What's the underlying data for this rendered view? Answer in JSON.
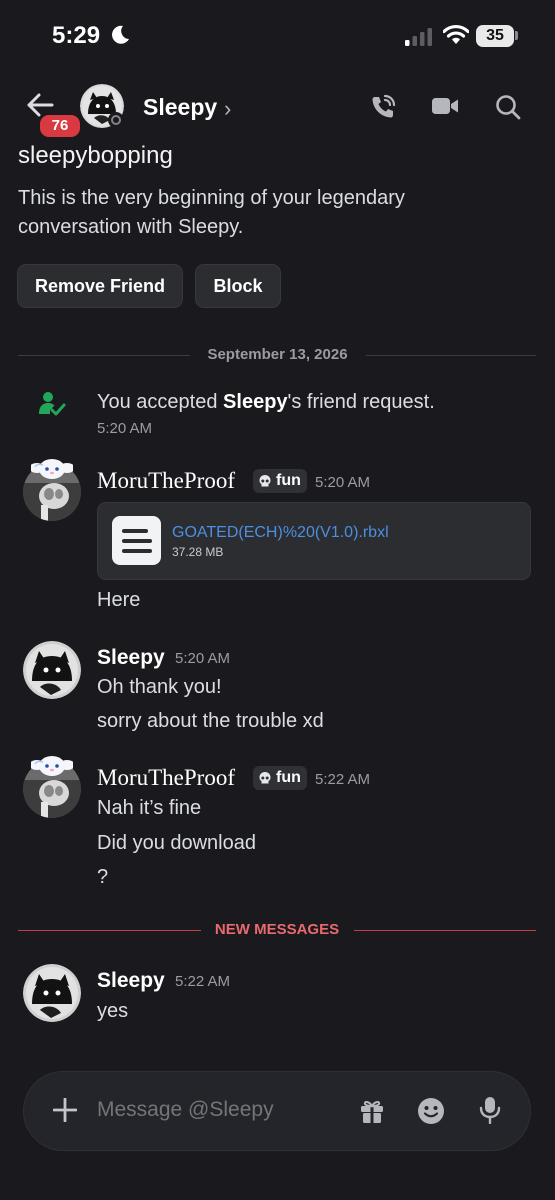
{
  "status_bar": {
    "time": "5:29",
    "battery": "35"
  },
  "header": {
    "unread_count": "76",
    "name": "Sleepy",
    "chevron": "›"
  },
  "intro": {
    "username": "sleepybopping",
    "text": "This is the very beginning of your legendary conversation with Sleepy.",
    "remove_friend_label": "Remove Friend",
    "block_label": "Block"
  },
  "date_divider": "September 13, 2026",
  "system_message": {
    "pre": "You accepted ",
    "name": "Sleepy",
    "post": "'s friend request.",
    "time": "5:20 AM"
  },
  "messages": [
    {
      "author": "MoruTheProof",
      "tag": "fun",
      "time": "5:20 AM",
      "attachment": {
        "name": "GOATED(ECH)%20(V1.0).rbxl",
        "size": "37.28 MB"
      },
      "lines": [
        "Here"
      ]
    },
    {
      "author": "Sleepy",
      "time": "5:20 AM",
      "lines": [
        "Oh thank you!",
        "sorry about the trouble xd"
      ]
    },
    {
      "author": "MoruTheProof",
      "tag": "fun",
      "time": "5:22 AM",
      "lines": [
        "Nah it’s fine",
        "Did you download",
        "?"
      ]
    },
    {
      "author": "Sleepy",
      "time": "5:22 AM",
      "lines": [
        "yes"
      ]
    }
  ],
  "new_messages_label": "NEW MESSAGES",
  "composer": {
    "placeholder": "Message @Sleepy"
  },
  "colors": {
    "background": "#1a1a1e",
    "accent_link": "#4d8fe0",
    "new_messages": "#e0464c",
    "online_green": "#23a55a",
    "badge_red": "#d93a41"
  }
}
